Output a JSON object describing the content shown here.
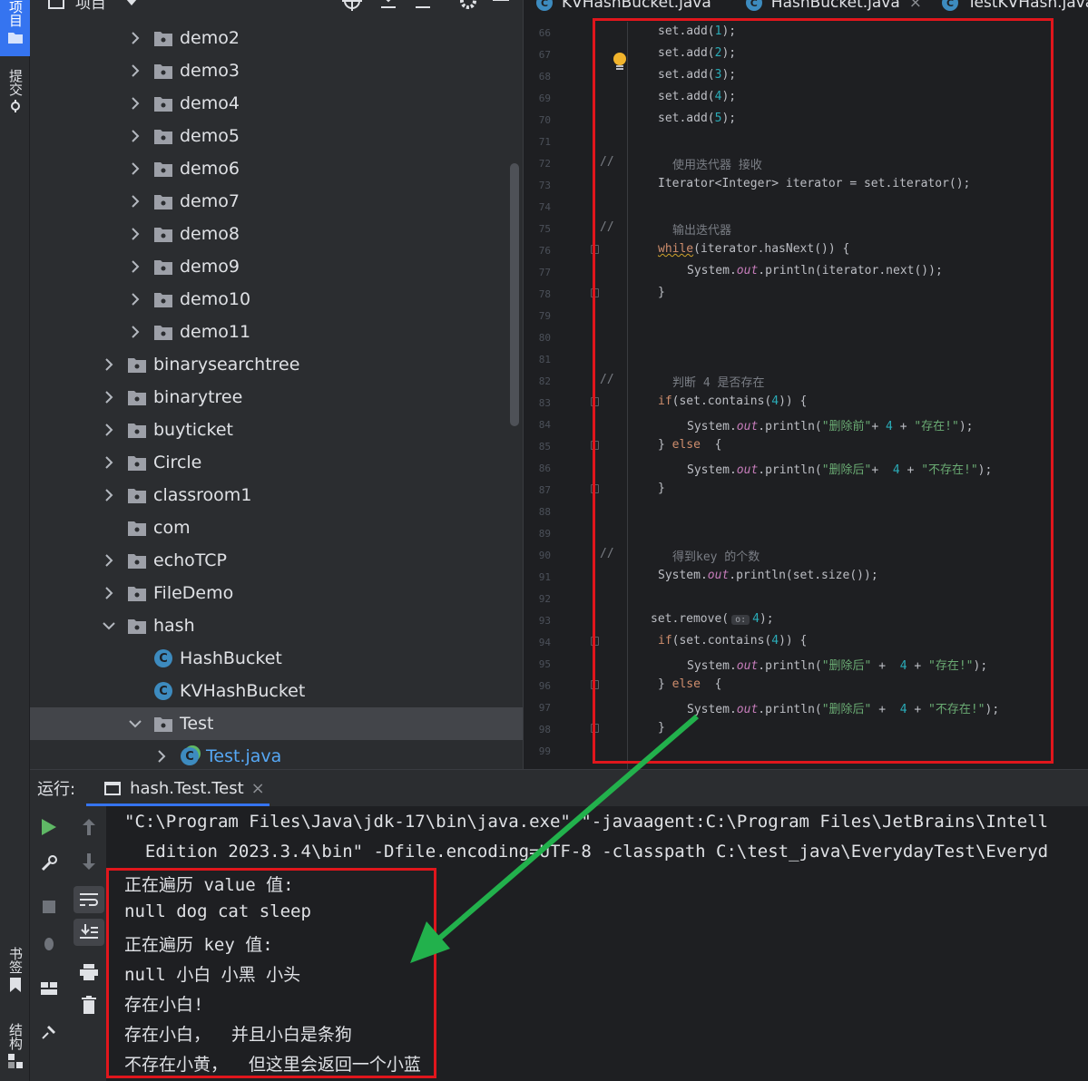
{
  "strip": {
    "project_tab": "项目",
    "commit_tab": "提交",
    "bookmarks_tab": "书签",
    "structure_tab": "结构"
  },
  "project": {
    "title": "项目",
    "tree": [
      {
        "label": "demo2",
        "indent": 2,
        "arrow": "right",
        "icon": "folder"
      },
      {
        "label": "demo3",
        "indent": 2,
        "arrow": "right",
        "icon": "folder"
      },
      {
        "label": "demo4",
        "indent": 2,
        "arrow": "right",
        "icon": "folder"
      },
      {
        "label": "demo5",
        "indent": 2,
        "arrow": "right",
        "icon": "folder"
      },
      {
        "label": "demo6",
        "indent": 2,
        "arrow": "right",
        "icon": "folder"
      },
      {
        "label": "demo7",
        "indent": 2,
        "arrow": "right",
        "icon": "folder"
      },
      {
        "label": "demo8",
        "indent": 2,
        "arrow": "right",
        "icon": "folder"
      },
      {
        "label": "demo9",
        "indent": 2,
        "arrow": "right",
        "icon": "folder"
      },
      {
        "label": "demo10",
        "indent": 2,
        "arrow": "right",
        "icon": "folder"
      },
      {
        "label": "demo11",
        "indent": 2,
        "arrow": "right",
        "icon": "folder"
      },
      {
        "label": "binarysearchtree",
        "indent": 1,
        "arrow": "right",
        "icon": "folder"
      },
      {
        "label": "binarytree",
        "indent": 1,
        "arrow": "right",
        "icon": "folder"
      },
      {
        "label": "buyticket",
        "indent": 1,
        "arrow": "right",
        "icon": "folder"
      },
      {
        "label": "Circle",
        "indent": 1,
        "arrow": "right",
        "icon": "folder"
      },
      {
        "label": "classroom1",
        "indent": 1,
        "arrow": "right",
        "icon": "folder"
      },
      {
        "label": "com",
        "indent": 1,
        "arrow": "none",
        "icon": "folder"
      },
      {
        "label": "echoTCP",
        "indent": 1,
        "arrow": "right",
        "icon": "folder"
      },
      {
        "label": "FileDemo",
        "indent": 1,
        "arrow": "right",
        "icon": "folder"
      },
      {
        "label": "hash",
        "indent": 1,
        "arrow": "down",
        "icon": "folder"
      },
      {
        "label": "HashBucket",
        "indent": 2,
        "arrow": "none",
        "icon": "class"
      },
      {
        "label": "KVHashBucket",
        "indent": 2,
        "arrow": "none",
        "icon": "class"
      },
      {
        "label": "Test",
        "indent": 2,
        "arrow": "down",
        "icon": "folder",
        "selected": true
      },
      {
        "label": "Test.java",
        "indent": 3,
        "arrow": "right",
        "icon": "class-run",
        "link": true
      }
    ]
  },
  "editor": {
    "tabs": [
      "KVHashBucket.java",
      "HashBucket.java",
      "TestKVHash.java"
    ],
    "line_numbers": [
      "66",
      "67",
      "68",
      "69",
      "70",
      "71",
      "72",
      "73",
      "74",
      "75",
      "76",
      "77",
      "78",
      "79",
      "80",
      "81",
      "82",
      "83",
      "84",
      "85",
      "86",
      "87",
      "88",
      "89",
      "90",
      "91",
      "92",
      "93",
      "94",
      "95",
      "96",
      "97",
      "98",
      "99"
    ],
    "comments": {
      "c72": "//",
      "c72b": "使用迭代器 接收",
      "c75": "//",
      "c75b": "输出迭代器",
      "c82": "//",
      "c82b": "判断 4 是否存在",
      "c90": "//",
      "c90b": "得到key 的个数"
    },
    "strings": {
      "before": "\"删除前\"",
      "after": "\"删除后\"",
      "exists": "\"存在!\"",
      "not_exists": "\"不存在!\""
    },
    "hint": "o:"
  },
  "run": {
    "label": "运行:",
    "tab": "hash.Test.Test",
    "console": [
      "\"C:\\Program Files\\Java\\jdk-17\\bin\\java.exe\" \"-javaagent:C:\\Program Files\\JetBrains\\Intell",
      "  Edition 2023.3.4\\bin\" -Dfile.encoding=UTF-8 -classpath C:\\test_java\\EverydayTest\\Everyd",
      "正在遍历 value 值:",
      "null dog cat sleep",
      "正在遍历 key 值:",
      "null 小白 小黑 小头",
      "存在小白!",
      "存在小白，  并且小白是条狗",
      "不存在小黄，  但这里会返回一个小蓝"
    ]
  },
  "colors": {
    "accent": "#3574f0",
    "highlight_box": "#e0161c",
    "arrow": "#22b14c"
  }
}
